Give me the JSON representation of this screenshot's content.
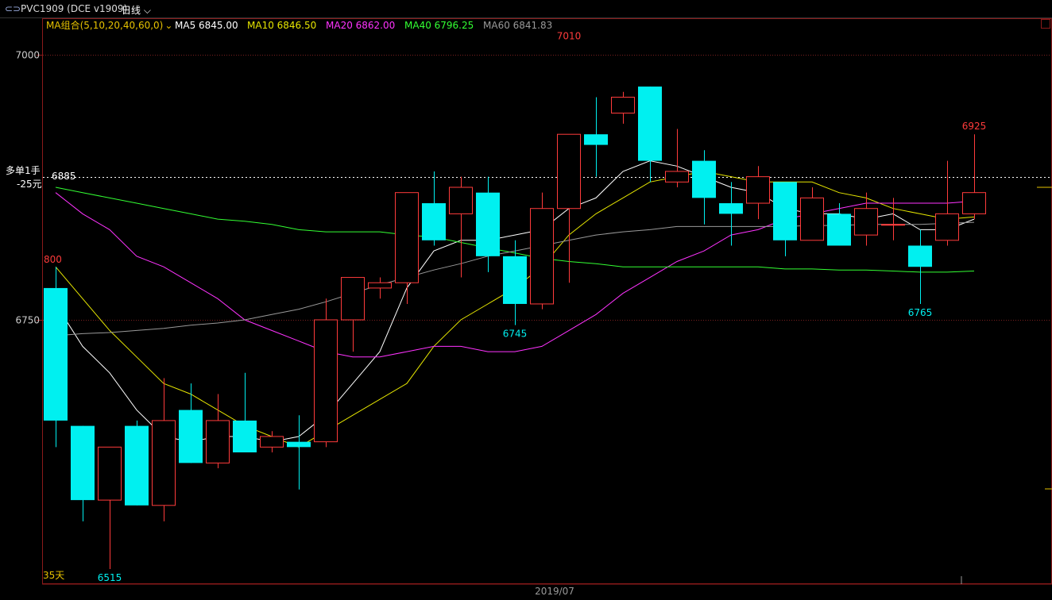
{
  "header": {
    "symbol_label": "PVC1909 (DCE v1909)",
    "period_label": "日线"
  },
  "ma_bar": {
    "group_label": "MA组合(5,10,20,40,60,0)",
    "items": [
      {
        "label": "MA5 6845.00",
        "color": "#ffffff"
      },
      {
        "label": "MA10 6846.50",
        "color": "#e6e600"
      },
      {
        "label": "MA20 6862.00",
        "color": "#ff33ff"
      },
      {
        "label": "MA40 6796.25",
        "color": "#33ff33"
      },
      {
        "label": "MA60 6841.83",
        "color": "#999999"
      }
    ]
  },
  "position": {
    "line1": "多单1手",
    "line2": "-25元",
    "price_label": "6885"
  },
  "left_markers": {
    "upper": "800",
    "lower": "35天"
  },
  "colors": {
    "up": "#ff3b3b",
    "down": "#00f0f0",
    "grid": "#7a1f1f",
    "axis": "#8b1a1a"
  },
  "chart_data": {
    "type": "candlestick",
    "ylim": [
      6510,
      7040
    ],
    "y_ticks": [
      {
        "value": 7000,
        "label": "7000"
      },
      {
        "value": 6750,
        "label": "6750"
      }
    ],
    "x_label": "2019/07",
    "position_price": 6885,
    "candles": [
      {
        "o": 6780,
        "h": 6800,
        "l": 6630,
        "c": 6655
      },
      {
        "o": 6650,
        "h": 6650,
        "l": 6560,
        "c": 6580
      },
      {
        "o": 6580,
        "h": 6620,
        "l": 6515,
        "c": 6630
      },
      {
        "o": 6650,
        "h": 6655,
        "l": 6585,
        "c": 6575
      },
      {
        "o": 6575,
        "h": 6695,
        "l": 6560,
        "c": 6655
      },
      {
        "o": 6665,
        "h": 6690,
        "l": 6625,
        "c": 6615
      },
      {
        "o": 6615,
        "h": 6680,
        "l": 6610,
        "c": 6655
      },
      {
        "o": 6655,
        "h": 6700,
        "l": 6625,
        "c": 6625
      },
      {
        "o": 6630,
        "h": 6645,
        "l": 6625,
        "c": 6640
      },
      {
        "o": 6635,
        "h": 6660,
        "l": 6590,
        "c": 6630
      },
      {
        "o": 6635,
        "h": 6770,
        "l": 6630,
        "c": 6750
      },
      {
        "o": 6750,
        "h": 6790,
        "l": 6720,
        "c": 6790
      },
      {
        "o": 6780,
        "h": 6790,
        "l": 6770,
        "c": 6785
      },
      {
        "o": 6785,
        "h": 6835,
        "l": 6765,
        "c": 6870
      },
      {
        "o": 6860,
        "h": 6890,
        "l": 6820,
        "c": 6825
      },
      {
        "o": 6850,
        "h": 6885,
        "l": 6790,
        "c": 6875
      },
      {
        "o": 6870,
        "h": 6885,
        "l": 6795,
        "c": 6810
      },
      {
        "o": 6810,
        "h": 6825,
        "l": 6745,
        "c": 6765
      },
      {
        "o": 6765,
        "h": 6870,
        "l": 6760,
        "c": 6855
      },
      {
        "o": 6855,
        "h": 6905,
        "l": 6785,
        "c": 6925
      },
      {
        "o": 6925,
        "h": 6960,
        "l": 6885,
        "c": 6915
      },
      {
        "o": 6945,
        "h": 6965,
        "l": 6935,
        "c": 6960
      },
      {
        "o": 6970,
        "h": 6955,
        "l": 6880,
        "c": 6900
      },
      {
        "o": 6880,
        "h": 6930,
        "l": 6875,
        "c": 6890
      },
      {
        "o": 6900,
        "h": 6910,
        "l": 6840,
        "c": 6865
      },
      {
        "o": 6860,
        "h": 6880,
        "l": 6820,
        "c": 6850
      },
      {
        "o": 6860,
        "h": 6895,
        "l": 6845,
        "c": 6885
      },
      {
        "o": 6880,
        "h": 6880,
        "l": 6810,
        "c": 6825
      },
      {
        "o": 6825,
        "h": 6875,
        "l": 6825,
        "c": 6865
      },
      {
        "o": 6850,
        "h": 6860,
        "l": 6820,
        "c": 6820
      },
      {
        "o": 6830,
        "h": 6870,
        "l": 6820,
        "c": 6855
      },
      {
        "o": 6840,
        "h": 6865,
        "l": 6825,
        "c": 6840
      },
      {
        "o": 6820,
        "h": 6835,
        "l": 6765,
        "c": 6800
      },
      {
        "o": 6825,
        "h": 6900,
        "l": 6820,
        "c": 6850
      },
      {
        "o": 6850,
        "h": 6925,
        "l": 6845,
        "c": 6870
      }
    ],
    "ma": [
      {
        "name": "MA5",
        "color": "#ffffff",
        "values": [
          6765,
          6725,
          6700,
          6665,
          6640,
          6635,
          6640,
          6640,
          6635,
          6640,
          6660,
          6690,
          6720,
          6780,
          6815,
          6825,
          6825,
          6830,
          6835,
          6855,
          6865,
          6890,
          6900,
          6895,
          6885,
          6875,
          6870,
          6855,
          6850,
          6850,
          6845,
          6850,
          6835,
          6835,
          6845
        ]
      },
      {
        "name": "MA10",
        "color": "#e6e600",
        "values": [
          6800,
          6770,
          6740,
          6715,
          6690,
          6680,
          6665,
          6650,
          6640,
          6630,
          6645,
          6660,
          6675,
          6690,
          6725,
          6750,
          6765,
          6780,
          6800,
          6830,
          6850,
          6865,
          6880,
          6885,
          6890,
          6885,
          6880,
          6880,
          6880,
          6870,
          6865,
          6855,
          6850,
          6845,
          6847
        ]
      },
      {
        "name": "MA20",
        "color": "#ff33ff",
        "values": [
          6870,
          6850,
          6835,
          6810,
          6800,
          6785,
          6770,
          6750,
          6740,
          6730,
          6720,
          6715,
          6715,
          6720,
          6725,
          6725,
          6720,
          6720,
          6725,
          6740,
          6755,
          6775,
          6790,
          6805,
          6815,
          6830,
          6835,
          6845,
          6850,
          6855,
          6860,
          6860,
          6860,
          6860,
          6862
        ]
      },
      {
        "name": "MA40",
        "color": "#33ff33",
        "values": [
          6875,
          6870,
          6865,
          6860,
          6855,
          6850,
          6845,
          6843,
          6840,
          6835,
          6833,
          6833,
          6833,
          6830,
          6828,
          6823,
          6818,
          6813,
          6808,
          6805,
          6803,
          6800,
          6800,
          6800,
          6800,
          6800,
          6800,
          6798,
          6798,
          6797,
          6797,
          6796,
          6795,
          6795,
          6796
        ]
      },
      {
        "name": "MA60",
        "color": "#999999",
        "values": [
          6735,
          6737,
          6738,
          6740,
          6742,
          6745,
          6747,
          6750,
          6755,
          6760,
          6767,
          6775,
          6783,
          6790,
          6797,
          6803,
          6810,
          6815,
          6820,
          6825,
          6830,
          6833,
          6835,
          6838,
          6838,
          6838,
          6838,
          6838,
          6839,
          6839,
          6840,
          6840,
          6840,
          6841,
          6842
        ]
      }
    ],
    "annotations": [
      {
        "label": "7010",
        "value": 7010,
        "candle": 19,
        "kind": "high"
      },
      {
        "label": "6745",
        "value": 6745,
        "candle": 17,
        "kind": "low"
      },
      {
        "label": "6925",
        "value": 6925,
        "candle": 34,
        "kind": "high"
      },
      {
        "label": "6765",
        "value": 6765,
        "candle": 32,
        "kind": "low"
      },
      {
        "label": "6515",
        "value": 6515,
        "candle": 2,
        "kind": "low"
      }
    ]
  }
}
